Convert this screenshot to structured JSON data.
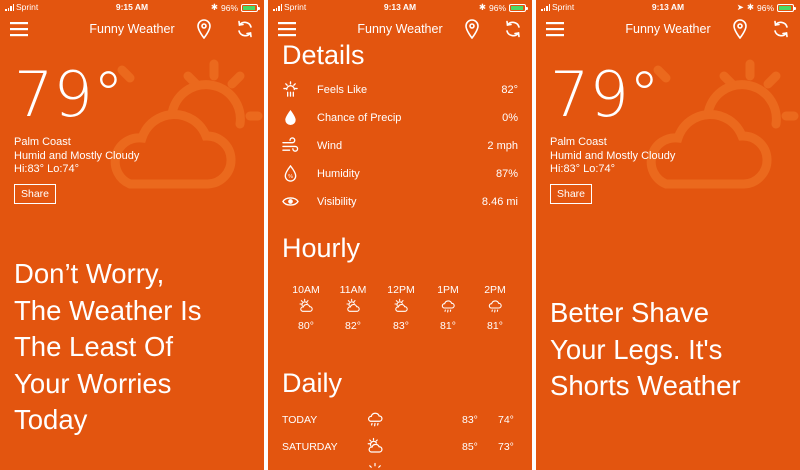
{
  "colors": {
    "background": "#e3550f",
    "text": "#ffffff",
    "battery": "#4cd964"
  },
  "screens": [
    {
      "status": {
        "carrier": "Sprint",
        "time": "9:15 AM",
        "battery": "96%",
        "battery_level": 0.96
      },
      "title": "Funny Weather",
      "temperature": "79°",
      "city": "Palm Coast",
      "condition": "Humid and Mostly Cloudy",
      "hilo": "Hi:83° Lo:74°",
      "share_label": "Share",
      "quote": [
        "Don’t Worry,",
        "The Weather Is",
        "The Least Of",
        "Your Worries",
        "Today"
      ]
    },
    {
      "status": {
        "carrier": "Sprint",
        "time": "9:13 AM",
        "battery": "96%",
        "battery_level": 0.96
      },
      "title": "Funny Weather",
      "details_title": "Details",
      "details": [
        {
          "icon": "feels-like-icon",
          "label": "Feels Like",
          "value": "82°"
        },
        {
          "icon": "raindrop-icon",
          "label": "Chance of Precip",
          "value": "0%"
        },
        {
          "icon": "wind-icon",
          "label": "Wind",
          "value": "2 mph"
        },
        {
          "icon": "humidity-icon",
          "label": "Humidity",
          "value": "87%"
        },
        {
          "icon": "eye-icon",
          "label": "Visibility",
          "value": "8.46 mi"
        }
      ],
      "hourly_title": "Hourly",
      "hourly": [
        {
          "time": "10AM",
          "icon": "partly-sunny-icon",
          "temp": "80°"
        },
        {
          "time": "11AM",
          "icon": "partly-sunny-icon",
          "temp": "82°"
        },
        {
          "time": "12PM",
          "icon": "partly-sunny-icon",
          "temp": "83°"
        },
        {
          "time": "1PM",
          "icon": "rain-cloud-icon",
          "temp": "81°"
        },
        {
          "time": "2PM",
          "icon": "rain-cloud-icon",
          "temp": "81°"
        }
      ],
      "daily_title": "Daily",
      "daily": [
        {
          "day": "TODAY",
          "icon": "rain-cloud-icon",
          "hi": "83°",
          "lo": "74°"
        },
        {
          "day": "SATURDAY",
          "icon": "partly-sunny-icon",
          "hi": "85°",
          "lo": "73°"
        }
      ]
    },
    {
      "status": {
        "carrier": "Sprint",
        "time": "9:13 AM",
        "battery": "96%",
        "battery_level": 0.96
      },
      "title": "Funny Weather",
      "temperature": "79°",
      "city": "Palm Coast",
      "condition": "Humid and Mostly Cloudy",
      "hilo": "Hi:83° Lo:74°",
      "share_label": "Share",
      "quote": [
        "Better Shave",
        "Your Legs. It's",
        "Shorts Weather"
      ]
    }
  ]
}
